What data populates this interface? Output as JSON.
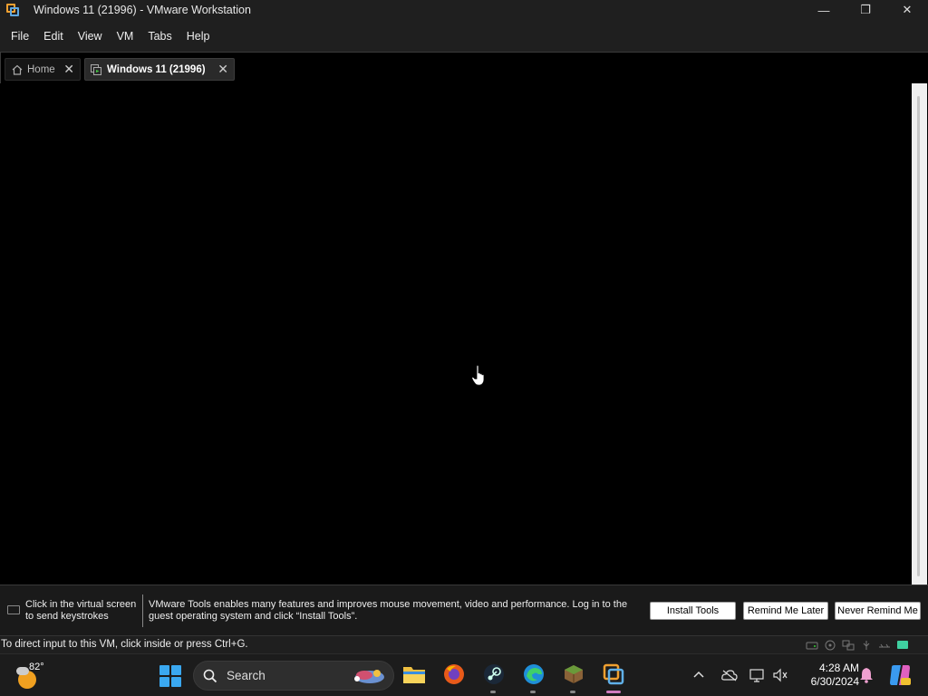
{
  "window": {
    "title": "Windows 11 (21996) - VMware Workstation",
    "minimize": "—",
    "restore": "❐",
    "close": "✕"
  },
  "menu": [
    "File",
    "Edit",
    "View",
    "VM",
    "Tabs",
    "Help"
  ],
  "tabs": [
    {
      "label": "Home",
      "icon": "home-icon",
      "close": "✕"
    },
    {
      "label": "Windows 11 (21996)",
      "icon": "vm-icon",
      "close": "✕"
    }
  ],
  "notification": {
    "hint": "Click in the virtual screen to send keystrokes",
    "message": "VMware Tools enables many features and improves mouse movement, video and performance. Log in to the guest operating system and click “Install Tools”.",
    "install_button": "Install Tools",
    "remind_button": "Remind Me Later",
    "never_button": "Never Remind Me"
  },
  "status": {
    "text": "To direct input to this VM, click inside or press Ctrl+G."
  },
  "taskbar": {
    "weather_temp": "82°",
    "search_label": "Search",
    "time": "4:28 AM",
    "date": "6/30/2024",
    "apps": [
      "file-explorer",
      "firefox",
      "steam",
      "edge",
      "minecraft",
      "vmware"
    ]
  },
  "colors": {
    "accent_blue": "#3aa8f0",
    "vmware_orange": "#f0a030",
    "active_indicator": "#d07cbf"
  }
}
